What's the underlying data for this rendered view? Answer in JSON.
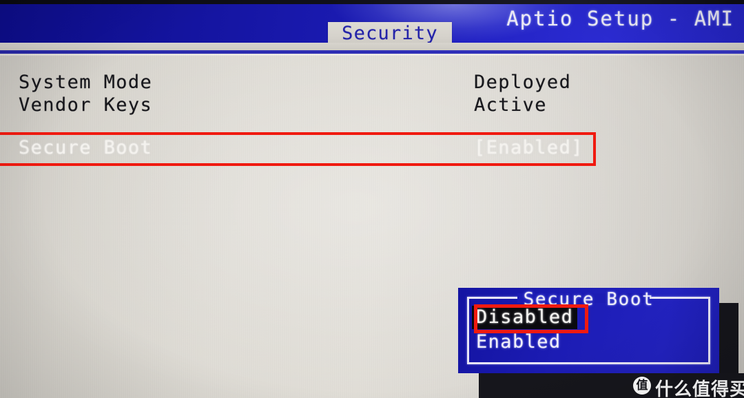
{
  "header": {
    "title": "Aptio Setup - AMI",
    "active_tab": "Security",
    "bar_color": "#1a1ab0",
    "tab_text_color": "#2323a8"
  },
  "settings": [
    {
      "label": "System Mode",
      "value": "Deployed",
      "tone": "dark"
    },
    {
      "label": "Vendor Keys",
      "value": "Active",
      "tone": "dark"
    },
    {
      "label": "Secure Boot",
      "value": "[Enabled]",
      "tone": "light"
    }
  ],
  "popup": {
    "title": "Secure Boot",
    "options": [
      {
        "label": "Disabled",
        "selected": true
      },
      {
        "label": "Enabled",
        "selected": false
      }
    ],
    "background_color": "#1c1cb4",
    "border_color": "#e8e6f6",
    "selected_highlight_color": "#0a0a0e"
  },
  "annotations": {
    "color": "#f01a10",
    "boxes": [
      {
        "name": "secure-boot-row-highlight",
        "target": "Secure Boot"
      },
      {
        "name": "disabled-option-highlight",
        "target": "Disabled"
      }
    ]
  },
  "watermark": {
    "logo_glyph": "值",
    "text": "什么值得买",
    "background_color": "#16161c",
    "text_color": "#ffffff"
  }
}
